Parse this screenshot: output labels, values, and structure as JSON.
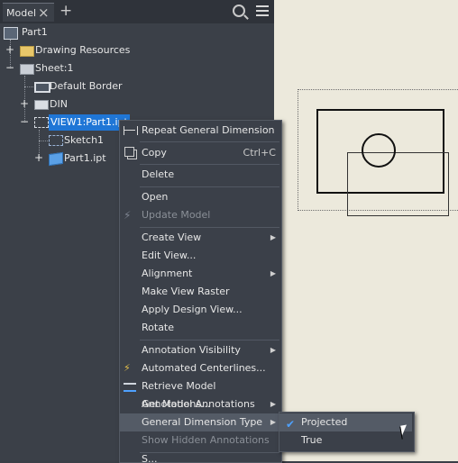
{
  "tab": {
    "label": "Model"
  },
  "tree": {
    "root": "Part1",
    "drawing_resources": "Drawing Resources",
    "sheet": "Sheet:1",
    "default_border": "Default Border",
    "din": "DIN",
    "view": "VIEW1:Part1.ipt",
    "sketch": "Sketch1",
    "part": "Part1.ipt"
  },
  "context_menu": {
    "repeat": "Repeat General Dimension",
    "copy": "Copy",
    "copy_shortcut": "Ctrl+C",
    "delete": "Delete",
    "open": "Open",
    "update_model": "Update Model",
    "create_view": "Create View",
    "edit_view": "Edit View...",
    "alignment": "Alignment",
    "make_view_raster": "Make View Raster",
    "apply_design_view": "Apply Design View...",
    "rotate": "Rotate",
    "annotation_visibility": "Annotation Visibility",
    "automated_centerlines": "Automated Centerlines...",
    "retrieve_model_annotations": "Retrieve Model Annotations...",
    "get_model_annotations": "Get Model Annotations",
    "general_dimension_type": "General Dimension Type",
    "show_hidden_annotations": "Show Hidden Annotations",
    "partial_item": "S..."
  },
  "submenu": {
    "projected": "Projected",
    "true": "True",
    "checked": "Projected"
  }
}
